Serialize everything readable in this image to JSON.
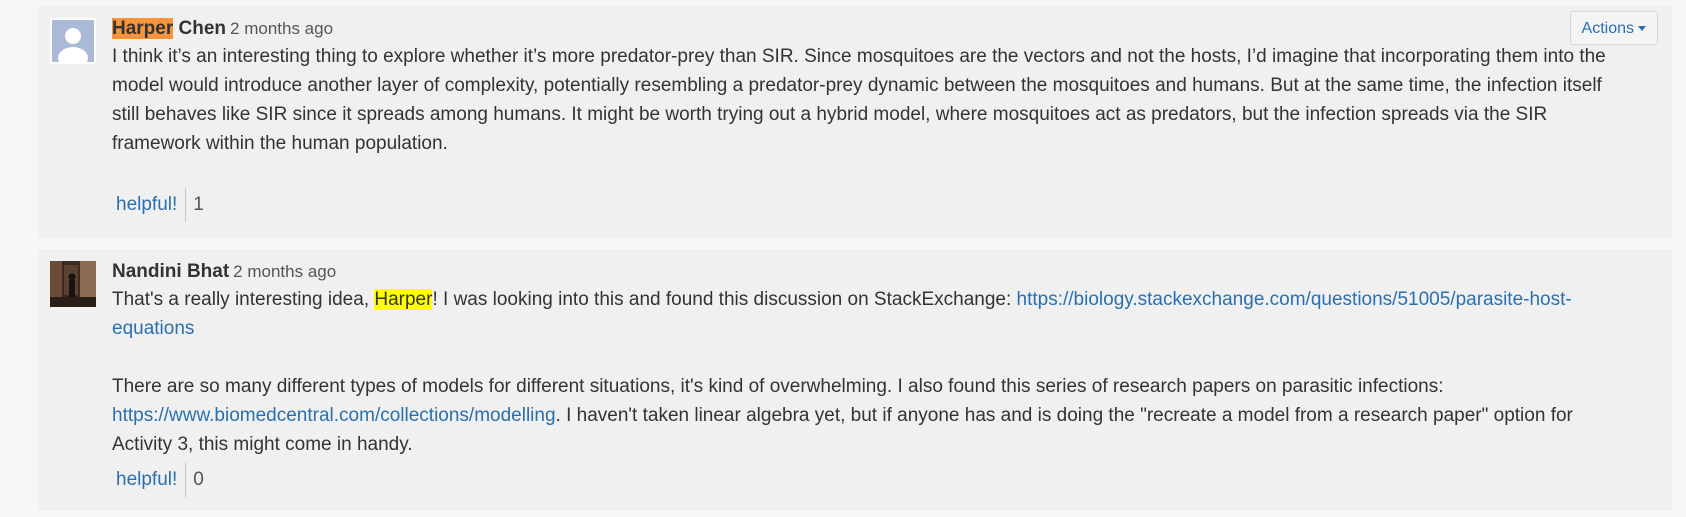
{
  "comments": [
    {
      "author_highlight": "Harper",
      "author_rest": " Chen",
      "timestamp": "2 months ago",
      "text": "I think it’s an interesting thing to explore whether it’s more predator-prey than SIR. Since mosquitoes are the vectors and not the hosts, I’d imagine that incorporating them into the model would introduce another layer of complexity, potentially resembling a predator-prey dynamic between the mosquitoes and humans. But at the same time, the infection itself still behaves like SIR since it spreads among humans. It might be worth trying out a hybrid model, where mosquitoes act as predators, but the infection spreads via the SIR framework within the human population.",
      "helpful_label": "helpful!",
      "helpful_count": "1",
      "avatar": "default-user-avatar"
    },
    {
      "author": "Nandini Bhat",
      "timestamp": "2 months ago",
      "p1_before": "That's a really interesting idea, ",
      "p1_mention": "Harper",
      "p1_after": "! I was looking into this and found this discussion on StackExchange: ",
      "p1_link": "https://biology.stackexchange.com/questions/51005/parasite-host-equations",
      "p2_before": "There are so many different types of models for different situations, it's kind of overwhelming. I also found this series of research papers on parasitic infections: ",
      "p2_link": "https://www.biomedcentral.com/collections/modelling",
      "p2_after": ". I haven't taken linear algebra yet, but if anyone has and is doing the \"recreate a model from a research paper\" option for Activity 3, this might come in handy.",
      "helpful_label": "helpful!",
      "helpful_count": "0",
      "avatar": "user-photo-avatar"
    }
  ],
  "actions_label": "Actions",
  "colors": {
    "link": "#2a6fb0",
    "highlight_orange": "#f7943c",
    "highlight_yellow": "#ffff00",
    "card_bg": "#f0f0f0"
  }
}
